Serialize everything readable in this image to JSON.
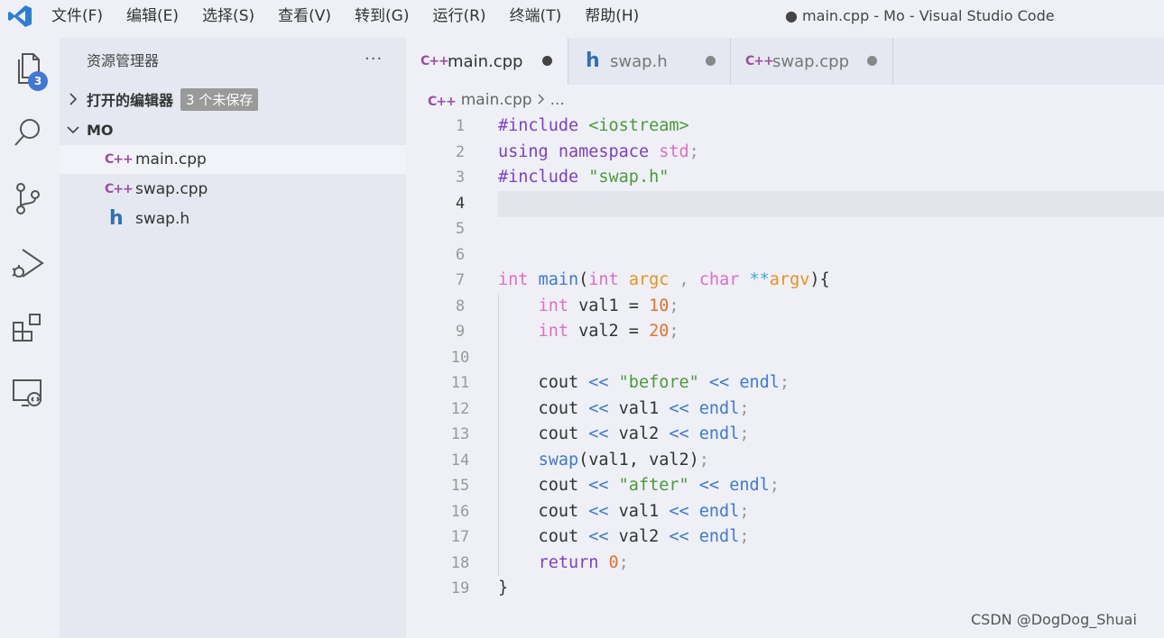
{
  "window": {
    "title": "● main.cpp - Mo - Visual Studio Code"
  },
  "menu": [
    "文件(F)",
    "编辑(E)",
    "选择(S)",
    "查看(V)",
    "转到(G)",
    "运行(R)",
    "终端(T)",
    "帮助(H)"
  ],
  "activity_bar": {
    "explorer_badge": "3",
    "icons": [
      "files-icon",
      "search-icon",
      "source-control-icon",
      "run-debug-icon",
      "extensions-icon",
      "remote-explorer-icon"
    ]
  },
  "sidebar": {
    "title": "资源管理器",
    "more": "···",
    "open_editors": {
      "label": "打开的编辑器",
      "badge": "3 个未保存"
    },
    "folder": {
      "label": "MO",
      "files": [
        {
          "name": "main.cpp",
          "type": "cpp",
          "active": true
        },
        {
          "name": "swap.cpp",
          "type": "cpp",
          "active": false
        },
        {
          "name": "swap.h",
          "type": "h",
          "active": false
        }
      ]
    }
  },
  "tabs": [
    {
      "label": "main.cpp",
      "type": "cpp",
      "active": true,
      "dirty": true
    },
    {
      "label": "swap.h",
      "type": "h",
      "active": false,
      "dirty": true
    },
    {
      "label": "swap.cpp",
      "type": "cpp",
      "active": false,
      "dirty": true
    }
  ],
  "breadcrumb": {
    "file": "main.cpp",
    "rest": "..."
  },
  "editor": {
    "current_line": 4,
    "lines": [
      [
        [
          "#include",
          "t-inc"
        ],
        [
          " ",
          "t-plain"
        ],
        [
          "<iostream>",
          "t-str"
        ]
      ],
      [
        [
          "using",
          "t-kw"
        ],
        [
          " ",
          "t-plain"
        ],
        [
          "namespace",
          "t-ns"
        ],
        [
          " ",
          "t-plain"
        ],
        [
          "std",
          "t-std"
        ],
        [
          ";",
          "t-punc"
        ]
      ],
      [
        [
          "#include",
          "t-inc"
        ],
        [
          " ",
          "t-plain"
        ],
        [
          "\"swap.h\"",
          "t-str"
        ]
      ],
      [],
      [],
      [],
      [
        [
          "int",
          "t-type"
        ],
        [
          " ",
          "t-plain"
        ],
        [
          "main",
          "t-fn"
        ],
        [
          "(",
          "t-plain"
        ],
        [
          "int",
          "t-type"
        ],
        [
          " ",
          "t-plain"
        ],
        [
          "argc",
          "t-param"
        ],
        [
          " , ",
          "t-punc"
        ],
        [
          "char",
          "t-type"
        ],
        [
          " ",
          "t-plain"
        ],
        [
          "**",
          "t-op"
        ],
        [
          "argv",
          "t-param"
        ],
        [
          "){",
          "t-plain"
        ]
      ],
      [
        [
          "    ",
          "t-plain"
        ],
        [
          "int",
          "t-type"
        ],
        [
          " val1 = ",
          "t-plain"
        ],
        [
          "10",
          "t-num"
        ],
        [
          ";",
          "t-punc"
        ]
      ],
      [
        [
          "    ",
          "t-plain"
        ],
        [
          "int",
          "t-type"
        ],
        [
          " val2 = ",
          "t-plain"
        ],
        [
          "20",
          "t-num"
        ],
        [
          ";",
          "t-punc"
        ]
      ],
      [],
      [
        [
          "    cout ",
          "t-plain"
        ],
        [
          "<<",
          "t-fn"
        ],
        [
          " ",
          "t-plain"
        ],
        [
          "\"before\"",
          "t-str"
        ],
        [
          " ",
          "t-plain"
        ],
        [
          "<<",
          "t-fn"
        ],
        [
          " ",
          "t-plain"
        ],
        [
          "endl",
          "t-fn"
        ],
        [
          ";",
          "t-punc"
        ]
      ],
      [
        [
          "    cout ",
          "t-plain"
        ],
        [
          "<<",
          "t-fn"
        ],
        [
          " val1 ",
          "t-plain"
        ],
        [
          "<<",
          "t-fn"
        ],
        [
          " ",
          "t-plain"
        ],
        [
          "endl",
          "t-fn"
        ],
        [
          ";",
          "t-punc"
        ]
      ],
      [
        [
          "    cout ",
          "t-plain"
        ],
        [
          "<<",
          "t-fn"
        ],
        [
          " val2 ",
          "t-plain"
        ],
        [
          "<<",
          "t-fn"
        ],
        [
          " ",
          "t-plain"
        ],
        [
          "endl",
          "t-fn"
        ],
        [
          ";",
          "t-punc"
        ]
      ],
      [
        [
          "    ",
          "t-plain"
        ],
        [
          "swap",
          "t-fn"
        ],
        [
          "(val1, val2)",
          "t-plain"
        ],
        [
          ";",
          "t-punc"
        ]
      ],
      [
        [
          "    cout ",
          "t-plain"
        ],
        [
          "<<",
          "t-fn"
        ],
        [
          " ",
          "t-plain"
        ],
        [
          "\"after\"",
          "t-str"
        ],
        [
          " ",
          "t-plain"
        ],
        [
          "<<",
          "t-fn"
        ],
        [
          " ",
          "t-plain"
        ],
        [
          "endl",
          "t-fn"
        ],
        [
          ";",
          "t-punc"
        ]
      ],
      [
        [
          "    cout ",
          "t-plain"
        ],
        [
          "<<",
          "t-fn"
        ],
        [
          " val1 ",
          "t-plain"
        ],
        [
          "<<",
          "t-fn"
        ],
        [
          " ",
          "t-plain"
        ],
        [
          "endl",
          "t-fn"
        ],
        [
          ";",
          "t-punc"
        ]
      ],
      [
        [
          "    cout ",
          "t-plain"
        ],
        [
          "<<",
          "t-fn"
        ],
        [
          " val2 ",
          "t-plain"
        ],
        [
          "<<",
          "t-fn"
        ],
        [
          " ",
          "t-plain"
        ],
        [
          "endl",
          "t-fn"
        ],
        [
          ";",
          "t-punc"
        ]
      ],
      [
        [
          "    ",
          "t-plain"
        ],
        [
          "return",
          "t-kw"
        ],
        [
          " ",
          "t-plain"
        ],
        [
          "0",
          "t-num"
        ],
        [
          ";",
          "t-punc"
        ]
      ],
      [
        [
          "}",
          "t-plain"
        ]
      ]
    ]
  },
  "watermark": "CSDN @DogDog_Shuai"
}
